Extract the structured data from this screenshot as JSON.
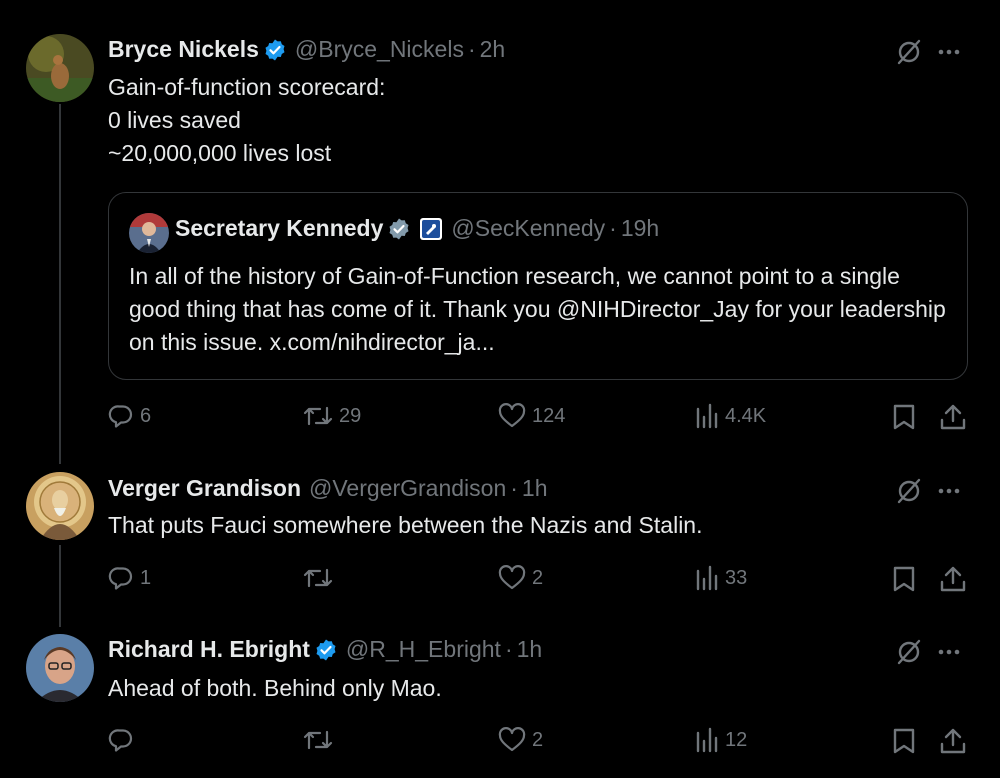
{
  "colors": {
    "background": "#000000",
    "text": "#e7e9ea",
    "muted": "#71767b",
    "verified": "#1d9bf0",
    "gov_badge": "#829aab",
    "border": "#333639"
  },
  "tweets": [
    {
      "name": "Bryce Nickels",
      "verified": true,
      "handle": "@Bryce_Nickels",
      "separator": "·",
      "time": "2h",
      "text": "Gain-of-function scorecard:\n0 lives saved\n~20,000,000 lives lost",
      "quote": {
        "name": "Secretary Kennedy",
        "verified": true,
        "gov_badge_icon": "government-badge-icon",
        "handle": "@SecKennedy",
        "separator": "·",
        "time": "19h",
        "text": "In all of the history of Gain-of-Function research, we cannot point to a single good thing that has come of it. Thank you @NIHDirector_Jay for your leadership on this issue. x.com/nihdirector_ja..."
      },
      "replies": "6",
      "reposts": "29",
      "likes": "124",
      "views": "4.4K"
    },
    {
      "name": "Verger Grandison",
      "verified": false,
      "handle": "@VergerGrandison",
      "separator": "·",
      "time": "1h",
      "text": "That puts Fauci somewhere between the Nazis and Stalin.",
      "replies": "1",
      "reposts": "",
      "likes": "2",
      "views": "33"
    },
    {
      "name": "Richard H. Ebright",
      "verified": true,
      "handle": "@R_H_Ebright",
      "separator": "·",
      "time": "1h",
      "text": "Ahead of both. Behind only Mao.",
      "replies": "",
      "reposts": "",
      "likes": "2",
      "views": "12"
    }
  ],
  "icons": [
    "grok-icon",
    "more-icon",
    "reply-icon",
    "repost-icon",
    "like-icon",
    "views-icon",
    "bookmark-icon",
    "share-icon"
  ]
}
